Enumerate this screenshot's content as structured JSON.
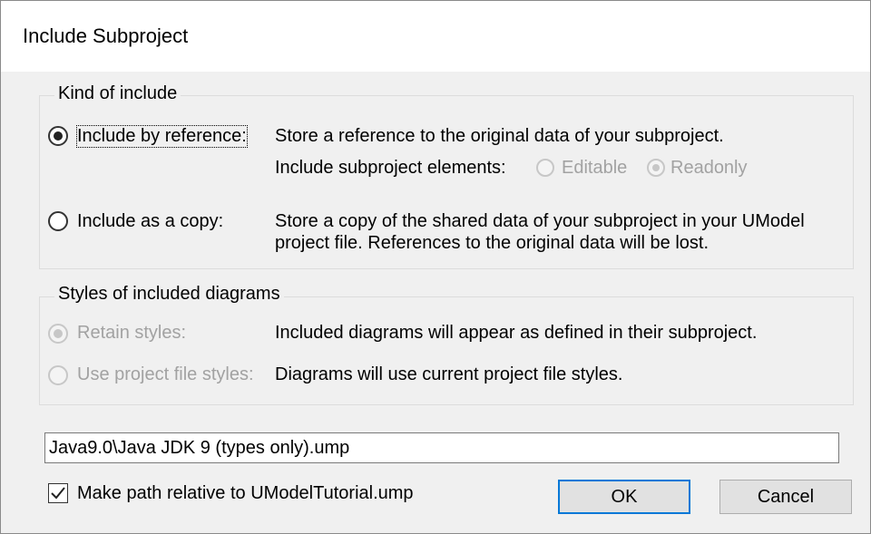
{
  "dialog": {
    "title": "Include Subproject"
  },
  "kind_group": {
    "legend": "Kind of include",
    "by_reference": {
      "label": "Include by reference:",
      "description": "Store a reference to the original data of your subproject.",
      "elements_label": "Include subproject elements:",
      "editable_label": "Editable",
      "readonly_label": "Readonly",
      "checked": true
    },
    "as_copy": {
      "label": "Include as a copy:",
      "description_line1": "Store a copy of the shared data of your subproject in your UModel",
      "description_line2": "project file. References to the original data will be lost.",
      "checked": false
    }
  },
  "styles_group": {
    "legend": "Styles of included diagrams",
    "retain": {
      "label": "Retain styles:",
      "description": "Included diagrams will appear as defined in their subproject.",
      "checked": true,
      "enabled": false
    },
    "project_file": {
      "label": "Use project file styles:",
      "description": "Diagrams will use current project file styles.",
      "checked": false,
      "enabled": false
    }
  },
  "path_field": {
    "value": "Java9.0\\Java JDK 9 (types only).ump"
  },
  "relative_checkbox": {
    "label": "Make path relative to UModelTutorial.ump",
    "checked": true
  },
  "buttons": {
    "ok": "OK",
    "cancel": "Cancel"
  },
  "colors": {
    "accent": "#0078d7",
    "disabled_text": "#a2a2a2",
    "dialog_bg": "#f0f0f0"
  }
}
